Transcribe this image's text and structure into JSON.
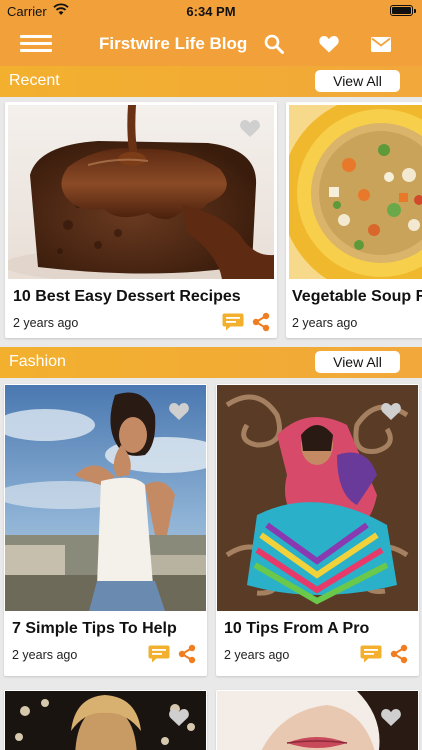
{
  "status_bar": {
    "carrier": "Carrier",
    "time": "6:34 PM"
  },
  "nav": {
    "title": "Firstwire Life Blog"
  },
  "sections": [
    {
      "label": "Recent",
      "view_all": "View All",
      "cards": [
        {
          "title": "10 Best Easy Dessert Recipes",
          "time": "2 years ago"
        },
        {
          "title": "Vegetable Soup R",
          "time": "2 years ago"
        }
      ]
    },
    {
      "label": "Fashion",
      "view_all": "View All",
      "cards": [
        {
          "title": "7 Simple Tips To Help",
          "time": "2 years ago"
        },
        {
          "title": "10 Tips From A Pro",
          "time": "2 years ago"
        }
      ]
    }
  ],
  "colors": {
    "brand": "#f2a13a",
    "accent_icon": "#f07d1f",
    "comment_icon": "#f2b02e"
  },
  "icons": [
    "menu-icon",
    "search-icon",
    "heart-icon",
    "mail-icon",
    "comment-icon",
    "share-icon"
  ]
}
